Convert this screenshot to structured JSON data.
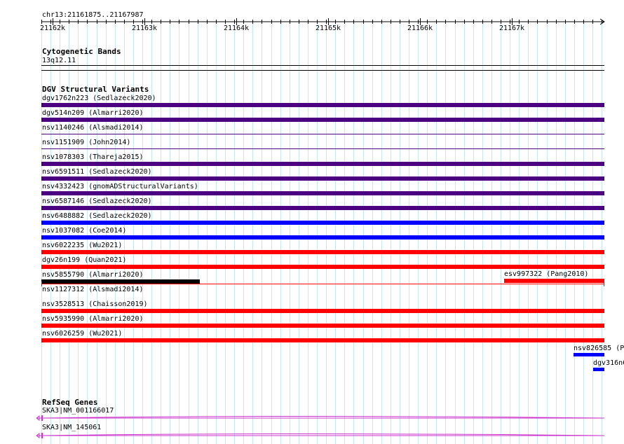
{
  "ruler": {
    "region": "chr13:21161875..21167987",
    "ticks": [
      "21162k",
      "21163k",
      "21164k",
      "21165k",
      "21166k",
      "21167k"
    ]
  },
  "cyto": {
    "title": "Cytogenetic Bands",
    "band": "13q12.11"
  },
  "dgv": {
    "title": "DGV Structural Variants",
    "colors": {
      "purple": "#4b0082",
      "blue": "#0000ff",
      "red": "#ff0000",
      "black": "#000000"
    },
    "rows": [
      {
        "label": "dgv1762n223 (Sedlazeck2020)",
        "color": "purple",
        "style": "thick"
      },
      {
        "label": "dgv514n209 (Almarri2020)",
        "color": "purple",
        "style": "thick"
      },
      {
        "label": "nsv1140246 (Alsmadi2014)",
        "color": "purple",
        "style": "thin"
      },
      {
        "label": "nsv1151909 (John2014)",
        "color": "purple",
        "style": "thin"
      },
      {
        "label": "nsv1078303 (Thareja2015)",
        "color": "purple",
        "style": "thick"
      },
      {
        "label": "nsv6591511 (Sedlazeck2020)",
        "color": "purple",
        "style": "thick"
      },
      {
        "label": "nsv4332423 (gnomADStructuralVariants)",
        "color": "purple",
        "style": "thick"
      },
      {
        "label": "nsv6587146 (Sedlazeck2020)",
        "color": "purple",
        "style": "thick"
      },
      {
        "label": "nsv6488882 (Sedlazeck2020)",
        "color": "blue",
        "style": "thick"
      },
      {
        "label": "nsv1037082 (Coe2014)",
        "color": "blue",
        "style": "thick"
      },
      {
        "label": "nsv6022235 (Wu2021)",
        "color": "red",
        "style": "thick"
      },
      {
        "label": "dgv26n199 (Quan2021)",
        "color": "red",
        "style": "thick"
      },
      {
        "label": "nsv5855790 (Almarri2020)",
        "color": "black",
        "style": "short"
      },
      {
        "label": "nsv1127312 (Alsmadi2014)",
        "color": "red",
        "style": "span"
      },
      {
        "label": "nsv3528513 (Chaisson2019)",
        "color": "red",
        "style": "thick"
      },
      {
        "label": "nsv5935990 (Almarri2020)",
        "color": "red",
        "style": "thick"
      },
      {
        "label": "nsv6026259 (Wu2021)",
        "color": "red",
        "style": "thick"
      }
    ],
    "extra_right": {
      "label": "esv997322 (Pang2010)",
      "color": "red"
    },
    "partial": [
      {
        "label": "nsv826585 (P",
        "color": "blue"
      },
      {
        "label": "dgv316n6",
        "color": "blue"
      }
    ]
  },
  "refseq": {
    "title": "RefSeq Genes",
    "color": "#cc33cc",
    "genes": [
      {
        "label": "SKA3|NM_001166017"
      },
      {
        "label": "SKA3|NM_145061"
      }
    ]
  }
}
